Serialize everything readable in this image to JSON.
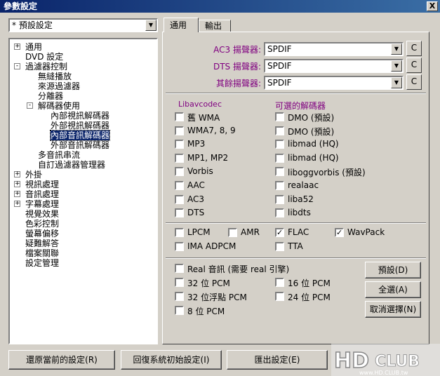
{
  "window": {
    "title": "參數設定",
    "close_glyph": "X"
  },
  "preset": {
    "value": "* 預設設定"
  },
  "tree": [
    {
      "label": "通用",
      "indent": 0,
      "exp": "+"
    },
    {
      "label": "DVD 設定",
      "indent": 0,
      "exp": ""
    },
    {
      "label": "過濾器控制",
      "indent": 0,
      "exp": "-"
    },
    {
      "label": "無縫播放",
      "indent": 1,
      "exp": ""
    },
    {
      "label": "來源過濾器",
      "indent": 1,
      "exp": ""
    },
    {
      "label": "分離器",
      "indent": 1,
      "exp": ""
    },
    {
      "label": "解碼器使用",
      "indent": 1,
      "exp": "-"
    },
    {
      "label": "內部視訊解碼器",
      "indent": 2,
      "exp": ""
    },
    {
      "label": "外部視訊解碼器",
      "indent": 2,
      "exp": ""
    },
    {
      "label": "內部音訊解碼器",
      "indent": 2,
      "exp": "",
      "selected": true
    },
    {
      "label": "外部音訊解碼器",
      "indent": 2,
      "exp": ""
    },
    {
      "label": "多音訊串流",
      "indent": 1,
      "exp": ""
    },
    {
      "label": "自訂過濾器管理器",
      "indent": 1,
      "exp": ""
    },
    {
      "label": "外掛",
      "indent": 0,
      "exp": "+"
    },
    {
      "label": "視訊處理",
      "indent": 0,
      "exp": "+"
    },
    {
      "label": "音訊處理",
      "indent": 0,
      "exp": "+"
    },
    {
      "label": "字幕處理",
      "indent": 0,
      "exp": "+"
    },
    {
      "label": "視覺效果",
      "indent": 0,
      "exp": ""
    },
    {
      "label": "色彩控制",
      "indent": 0,
      "exp": ""
    },
    {
      "label": "螢幕偏移",
      "indent": 0,
      "exp": ""
    },
    {
      "label": "疑難解答",
      "indent": 0,
      "exp": ""
    },
    {
      "label": "檔案關聯",
      "indent": 0,
      "exp": ""
    },
    {
      "label": "設定管理",
      "indent": 0,
      "exp": ""
    }
  ],
  "tabs": [
    {
      "label": "通用"
    },
    {
      "label": "輸出"
    }
  ],
  "renderers": [
    {
      "label": "AC3 揚聲器:",
      "value": "SPDIF",
      "btn": "C"
    },
    {
      "label": "DTS 揚聲器:",
      "value": "SPDIF",
      "btn": "C"
    },
    {
      "label": "其餘揚聲器:",
      "value": "SPDIF",
      "btn": "C"
    }
  ],
  "libavcodec": {
    "header": "Libavcodec",
    "items": [
      {
        "label": "舊 WMA",
        "checked": false
      },
      {
        "label": "WMA7, 8, 9",
        "checked": false
      },
      {
        "label": "MP3",
        "checked": false
      },
      {
        "label": "MP1, MP2",
        "checked": false
      },
      {
        "label": "Vorbis",
        "checked": false
      },
      {
        "label": "AAC",
        "checked": false
      },
      {
        "label": "AC3",
        "checked": false
      },
      {
        "label": "DTS",
        "checked": false
      }
    ]
  },
  "alt_decoders": {
    "header": "可選的解碼器",
    "items": [
      {
        "label": "DMO (預設)",
        "checked": false
      },
      {
        "label": "DMO (預設)",
        "checked": false
      },
      {
        "label": "libmad (HQ)",
        "checked": false
      },
      {
        "label": "libmad (HQ)",
        "checked": false
      },
      {
        "label": "liboggvorbis (預設)",
        "checked": false
      },
      {
        "label": "realaac",
        "checked": false
      },
      {
        "label": "liba52",
        "checked": false
      },
      {
        "label": "libdts",
        "checked": false
      }
    ]
  },
  "misc_codecs": [
    {
      "label": "LPCM",
      "checked": false
    },
    {
      "label": "AMR",
      "checked": false
    },
    {
      "label": "FLAC",
      "checked": true
    },
    {
      "label": "WavPack",
      "checked": true
    },
    {
      "label": "IMA ADPCM",
      "checked": false
    },
    {
      "label": "TTA",
      "checked": false
    }
  ],
  "pcm": [
    {
      "label": "Real 音訊 (需要 real 引擎)",
      "checked": false
    },
    {
      "label": "32 位 PCM",
      "checked": false
    },
    {
      "label": "16 位 PCM",
      "checked": false
    },
    {
      "label": "32 位浮點 PCM",
      "checked": false
    },
    {
      "label": "24 位 PCM",
      "checked": false
    },
    {
      "label": "8 位 PCM",
      "checked": false
    }
  ],
  "side_buttons": [
    {
      "label": "預設(D)"
    },
    {
      "label": "全選(A)"
    },
    {
      "label": "取消選擇(N)"
    }
  ],
  "bottom_buttons": [
    {
      "label": "還原當前的設定(R)"
    },
    {
      "label": "回復系統初始設定(I)"
    },
    {
      "label": "匯出設定(E)"
    }
  ],
  "watermark": {
    "logo": "HD",
    "suffix": "CLUB",
    "url": "www.HD.CLUB.tw"
  },
  "check_glyph": "✓"
}
